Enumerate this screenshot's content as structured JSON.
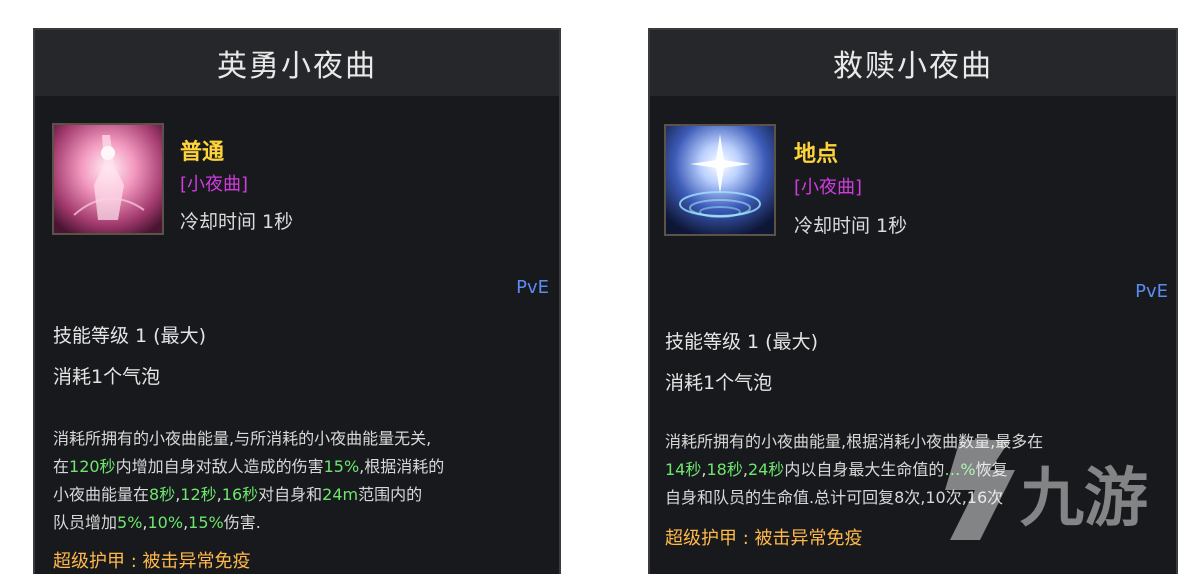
{
  "left": {
    "title": "英勇小夜曲",
    "skill_type": "普通",
    "tag": "[小夜曲]",
    "cooldown": "冷却时间 1秒",
    "mode": "PvE",
    "level": "技能等级 1 (最大)",
    "cost": "消耗1个气泡",
    "desc": {
      "l1": "消耗所拥有的小夜曲能量,与所消耗的小夜曲能量无关,",
      "l2a": "在",
      "l2b": "120秒",
      "l2c": "内增加自身对敌人造成的伤害",
      "l2d": "15%",
      "l2e": ",根据消耗的",
      "l3a": "小夜曲能量在",
      "l3b": "8秒",
      "l3c": ",",
      "l3d": "12秒",
      "l3e": ",",
      "l3f": "16秒",
      "l3g": "对自身和",
      "l3h": "24m",
      "l3i": "范围内的",
      "l4a": "队员增加",
      "l4b": "5%",
      "l4c": ",",
      "l4d": "10%",
      "l4e": ",",
      "l4f": "15%",
      "l4g": "伤害."
    },
    "armor": "超级护甲 : 被击异常免疫"
  },
  "right": {
    "title": "救赎小夜曲",
    "skill_type": "地点",
    "tag": "[小夜曲]",
    "cooldown": "冷却时间 1秒",
    "mode": "PvE",
    "level": "技能等级 1 (最大)",
    "cost": "消耗1个气泡",
    "desc": {
      "l1": "消耗所拥有的小夜曲能量,根据消耗小夜曲数量,最多在",
      "l2a": "14秒",
      "l2b": ",",
      "l2c": "18秒",
      "l2d": ",",
      "l2e": "24秒",
      "l2f": "内以自身最大生命值的",
      "l2g": "…%",
      "l2h": "恢复",
      "l3": "自身和队员的生命值.总计可回复8次,10次,16次",
      "l4": ""
    },
    "armor": "超级护甲 : 被击异常免疫"
  },
  "watermark": {
    "text": "九游"
  },
  "colors": {
    "gold": "#ffd43a",
    "purple": "#d23be0",
    "green": "#6ee66e",
    "orange": "#ffb84a",
    "blue": "#5b8cf0"
  }
}
